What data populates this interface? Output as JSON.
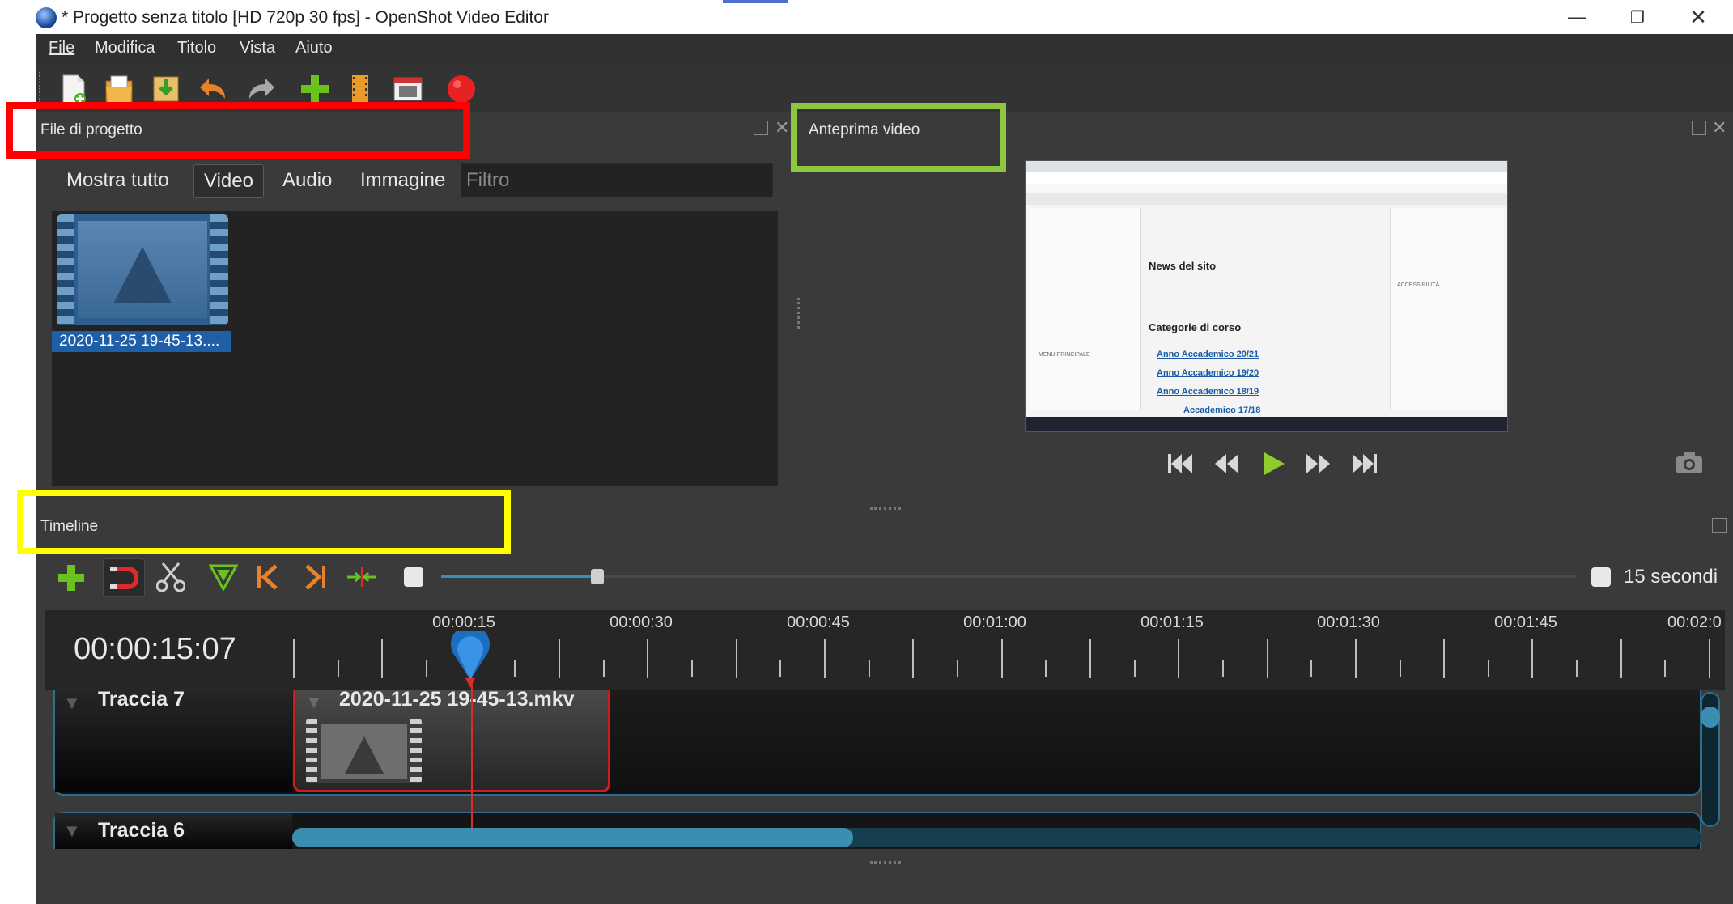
{
  "window": {
    "title": "* Progetto senza titolo [HD 720p 30 fps] - OpenShot Video Editor",
    "minimize_icon": "minimize-icon",
    "maximize_icon": "restore-icon",
    "close_icon": "close-icon"
  },
  "menubar": {
    "items": [
      "File",
      "Modifica",
      "Titolo",
      "Vista",
      "Aiuto"
    ]
  },
  "toolbar": {
    "icons": [
      "new-project-icon",
      "open-project-icon",
      "save-project-icon",
      "undo-icon",
      "redo-icon",
      "import-files-icon",
      "profile-icon",
      "fullscreen-icon",
      "export-video-icon"
    ]
  },
  "project_files": {
    "title": "File di progetto",
    "tabs": [
      "Mostra tutto",
      "Video",
      "Audio",
      "Immagine"
    ],
    "active_tab": "Video",
    "filter_placeholder": "Filtro",
    "files": [
      {
        "name": "2020-11-25 19-45-13...."
      }
    ]
  },
  "preview": {
    "title": "Anteprima video",
    "controls": [
      "jump-start-icon",
      "rewind-icon",
      "play-icon",
      "fast-forward-icon",
      "jump-end-icon"
    ],
    "snapshot_icon": "camera-icon",
    "screen": {
      "news_heading": "News del sito",
      "categories_heading": "Categorie di corso",
      "courses": [
        "Anno Accademico 20/21",
        "Anno Accademico 19/20",
        "Anno Accademico 18/19",
        "Accademico 17/18"
      ],
      "side_heading": "ACCESSIBILITÀ",
      "menu_heading": "MENU PRINCIPALE"
    }
  },
  "timeline": {
    "title": "Timeline",
    "zoom_label": "15 secondi",
    "current_time": "00:00:15:07",
    "ruler": [
      "00:00:15",
      "00:00:30",
      "00:00:45",
      "00:01:00",
      "00:01:15",
      "00:01:30",
      "00:01:45",
      "00:02:0"
    ],
    "tools": [
      "add-track-icon",
      "snap-icon",
      "razor-icon",
      "add-marker-icon",
      "previous-marker-icon",
      "next-marker-icon",
      "center-playhead-icon",
      "zoom-out-icon"
    ],
    "tracks": [
      {
        "name": "Traccia 7",
        "clip": "2020-11-25 19-45-13.mkv"
      },
      {
        "name": "Traccia 6"
      }
    ]
  },
  "annotations": {
    "red": "#ff0000",
    "green": "#8ec63f",
    "yellow": "#ffff00"
  }
}
